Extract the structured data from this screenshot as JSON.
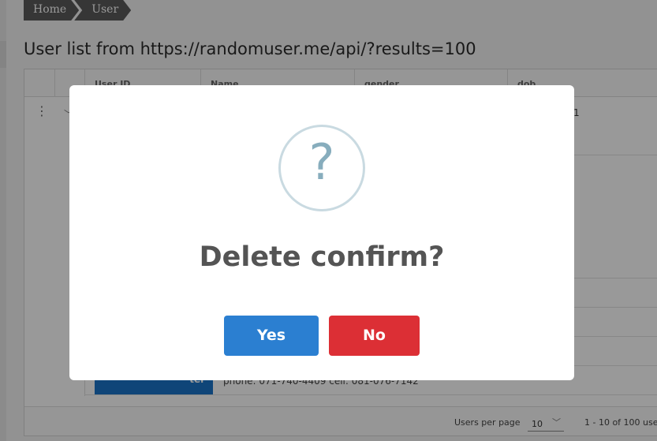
{
  "breadcrumb": {
    "items": [
      "Home",
      "User"
    ]
  },
  "page": {
    "title": "User list from https://randomuser.me/api/?results=100"
  },
  "grid": {
    "columns": [
      "User ID",
      "Name",
      "gender",
      "dob"
    ],
    "row_fragment": "1",
    "row_detail_fragment": "phone: 071-740-4409 cell: 081-076-7142",
    "blue_tag_fragment": "ter"
  },
  "pagination": {
    "per_page_label": "Users per page",
    "per_page_value": "10",
    "range_text": "1 - 10 of 100 users"
  },
  "dialog": {
    "icon": "question-mark-icon",
    "icon_glyph": "?",
    "title": "Delete confirm?",
    "yes_label": "Yes",
    "no_label": "No"
  },
  "colors": {
    "primary": "#2b7fd1",
    "danger": "#dc2f35",
    "icon_ring": "#c9dae1"
  }
}
